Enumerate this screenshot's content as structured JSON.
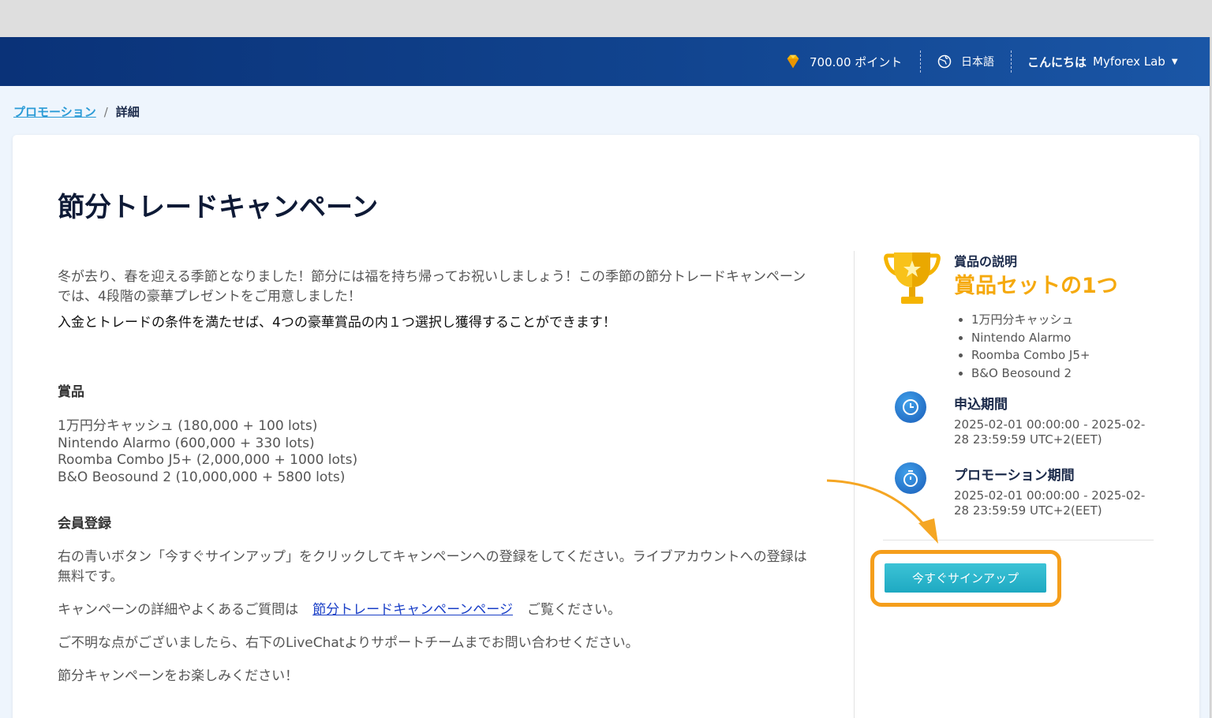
{
  "topbar": {
    "points": "700.00 ポイント",
    "language": "日本語",
    "greeting": "こんにちは",
    "username": "Myforex Lab"
  },
  "breadcrumb": {
    "parent": "プロモーション",
    "separator": "/",
    "current": "詳細"
  },
  "page": {
    "title": "節分トレードキャンペーン",
    "intro": "冬が去り、春を迎える季節となりました！節分には福を持ち帰ってお祝いしましょう！この季節の節分トレードキャンペーンでは、4段階の豪華プレゼントをご用意しました！",
    "intro_strong": "入金とトレードの条件を満たせば、4つの豪華賞品の内１つ選択し獲得することができます！",
    "prizes_heading": "賞品",
    "prizes": [
      "1万円分キャッシュ (180,000 + 100 lots)",
      "Nintendo Alarmo (600,000 + 330 lots)",
      "Roomba Combo J5+ (2,000,000 + 1000 lots)",
      "B&O Beosound 2 (10,000,000 + 5800 lots)"
    ],
    "registration_heading": "会員登録",
    "registration_text": "右の青いボタン「今すぐサインアップ」をクリックしてキャンペーンへの登録をしてください。ライブアカウントへの登録は無料です。",
    "details_prefix": "キャンペーンの詳細やよくあるご質問は",
    "details_link": "節分トレードキャンペーンページ",
    "details_suffix": "ご覧ください。",
    "support_text": "ご不明な点がございましたら、右下のLiveChatよりサポートチームまでお問い合わせください。",
    "closing": "節分キャンペーンをお楽しみください！"
  },
  "sidebar": {
    "prize_label": "賞品の説明",
    "prize_big": "賞品セットの1つ",
    "prize_items": [
      "1万円分キャッシュ",
      "Nintendo Alarmo",
      "Roomba Combo J5+",
      "B&O Beosound 2"
    ],
    "apply_title": "申込期間",
    "apply_period": "2025-02-01 00:00:00 - 2025-02-28 23:59:59 UTC+2(EET)",
    "promo_title": "プロモーション期間",
    "promo_period": "2025-02-01 00:00:00 - 2025-02-28 23:59:59 UTC+2(EET)",
    "signup_button": "今すぐサインアップ"
  },
  "colors": {
    "header_blue": "#11448f",
    "accent_orange": "#f5a90d",
    "button_teal": "#2bb5cc",
    "link_blue": "#1a3fc7"
  }
}
